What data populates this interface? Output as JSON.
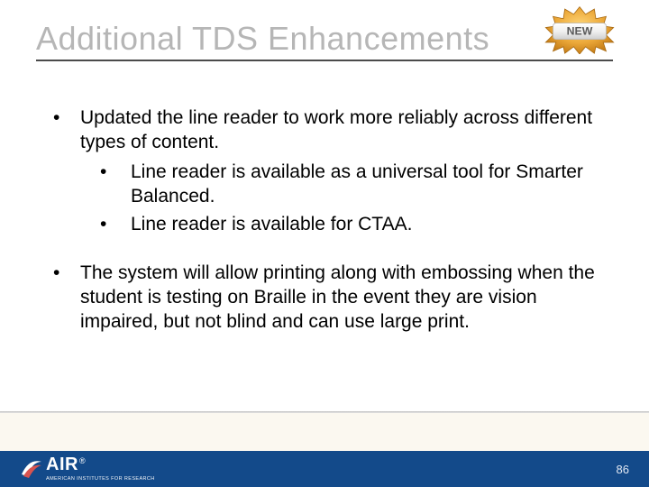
{
  "title": "Additional TDS Enhancements",
  "badge": {
    "label": "NEW",
    "name": "new-icon"
  },
  "bullets": [
    {
      "text": "Updated the line reader to work more reliably across different types of content.",
      "sub": [
        "Line reader is available as a universal tool for Smarter Balanced.",
        "Line reader is available for CTAA."
      ]
    },
    {
      "text": "The system will allow printing along with embossing when the student is testing on Braille in the event they are vision impaired, but not blind and can use large print.",
      "sub": []
    }
  ],
  "footer": {
    "logo_main": "AIR",
    "logo_sub": "AMERICAN INSTITUTES FOR RESEARCH",
    "reg": "®"
  },
  "page_number": "86",
  "colors": {
    "title_gray": "#b6b6b6",
    "footer_blue": "#134a8a",
    "badge_orange": "#e39a2f"
  }
}
